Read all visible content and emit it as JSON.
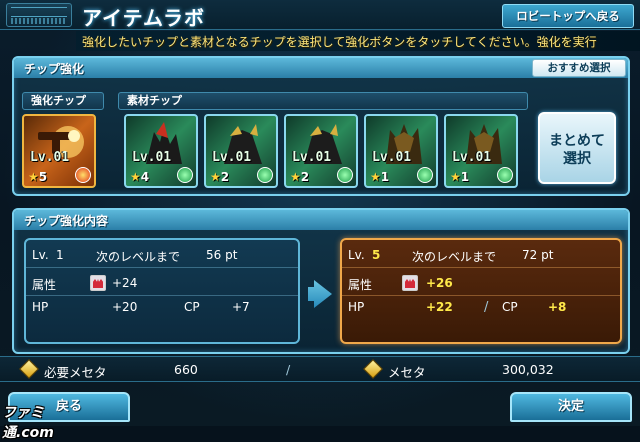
{
  "header": {
    "title": "アイテムラボ",
    "lobby_button": "ロビートップへ戻る"
  },
  "instruction": "強化したいチップと素材となるチップを選択して強化ボタンをタッチしてください。強化を実行",
  "chip_panel": {
    "title": "チップ強化",
    "recommend_button": "おすすめ選択",
    "enhance_label": "強化チップ",
    "material_label": "素材チップ",
    "bulk_button_line1": "まとめて",
    "bulk_button_line2": "選択",
    "enhance_chip": {
      "level": "Lv.01",
      "rarity": "5",
      "element": "fire"
    },
    "material_chips": [
      {
        "level": "Lv.01",
        "rarity": "4",
        "element": "wind"
      },
      {
        "level": "Lv.01",
        "rarity": "2",
        "element": "wind"
      },
      {
        "level": "Lv.01",
        "rarity": "2",
        "element": "wind"
      },
      {
        "level": "Lv.01",
        "rarity": "1",
        "element": "wind"
      },
      {
        "level": "Lv.01",
        "rarity": "1",
        "element": "wind"
      }
    ]
  },
  "details_panel": {
    "title": "チップ強化内容",
    "before": {
      "level_label": "Lv.",
      "level": "1",
      "next_label": "次のレベルまで",
      "next_pts": "56 pt",
      "attr_label": "属性",
      "attr_value": "+24",
      "hp_label": "HP",
      "hp_value": "+20",
      "cp_label": "CP",
      "cp_value": "+7"
    },
    "after": {
      "level_label": "Lv.",
      "level": "5",
      "next_label": "次のレベルまで",
      "next_pts": "72 pt",
      "attr_label": "属性",
      "attr_value": "+26",
      "hp_label": "HP",
      "hp_value": "+22",
      "cp_label": "CP",
      "cp_value": "+8"
    }
  },
  "meseta": {
    "required_label": "必要メセタ",
    "required_value": "660",
    "separator": "/",
    "owned_label": "メセタ",
    "owned_value": "300,032"
  },
  "buttons": {
    "back": "戻る",
    "confirm": "決定"
  },
  "watermark": "ファミ通.com",
  "colors": {
    "accent": "#5cb8da",
    "highlight": "#ffe94a",
    "after_border": "#f0a84a"
  }
}
